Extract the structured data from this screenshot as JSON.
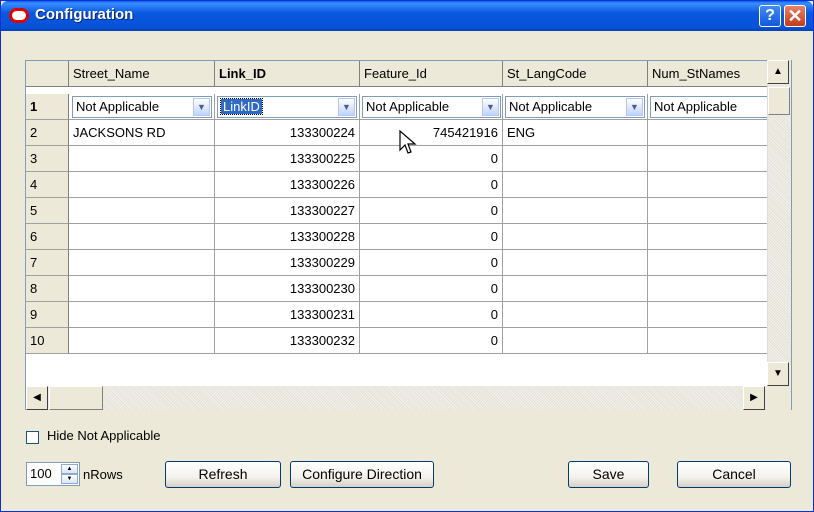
{
  "window": {
    "title": "Configuration",
    "help_label": "?",
    "close_label": "✕"
  },
  "grid": {
    "columns": [
      "Street_Name",
      "Link_ID",
      "Feature_Id",
      "St_LangCode",
      "Num_StNames"
    ],
    "mapping_row": {
      "row_label": "1",
      "values": [
        "Not Applicable",
        "LinkID",
        "Not Applicable",
        "Not Applicable",
        "Not Applicable"
      ]
    },
    "rows": [
      {
        "num": "2",
        "street_name": "JACKSONS RD",
        "link_id": "133300224",
        "feature_id": "745421916",
        "lang": "ENG",
        "num_stnames": ""
      },
      {
        "num": "3",
        "street_name": "",
        "link_id": "133300225",
        "feature_id": "0",
        "lang": "",
        "num_stnames": ""
      },
      {
        "num": "4",
        "street_name": "",
        "link_id": "133300226",
        "feature_id": "0",
        "lang": "",
        "num_stnames": ""
      },
      {
        "num": "5",
        "street_name": "",
        "link_id": "133300227",
        "feature_id": "0",
        "lang": "",
        "num_stnames": ""
      },
      {
        "num": "6",
        "street_name": "",
        "link_id": "133300228",
        "feature_id": "0",
        "lang": "",
        "num_stnames": ""
      },
      {
        "num": "7",
        "street_name": "",
        "link_id": "133300229",
        "feature_id": "0",
        "lang": "",
        "num_stnames": ""
      },
      {
        "num": "8",
        "street_name": "",
        "link_id": "133300230",
        "feature_id": "0",
        "lang": "",
        "num_stnames": ""
      },
      {
        "num": "9",
        "street_name": "",
        "link_id": "133300231",
        "feature_id": "0",
        "lang": "",
        "num_stnames": ""
      },
      {
        "num": "10",
        "street_name": "",
        "link_id": "133300232",
        "feature_id": "0",
        "lang": "",
        "num_stnames": ""
      }
    ]
  },
  "options": {
    "hide_not_applicable_label": "Hide Not Applicable",
    "hide_not_applicable_checked": false
  },
  "footer": {
    "nrows_value": "100",
    "nrows_label": "nRows",
    "refresh_label": "Refresh",
    "configure_direction_label": "Configure Direction",
    "save_label": "Save",
    "cancel_label": "Cancel"
  },
  "colors": {
    "titlebar": "#0653D8",
    "selection": "#316AC5",
    "dialog_bg": "#ECE9D8"
  },
  "icons": {
    "app": "oracle-logo-icon",
    "cursor": "mouse-pointer-icon"
  }
}
